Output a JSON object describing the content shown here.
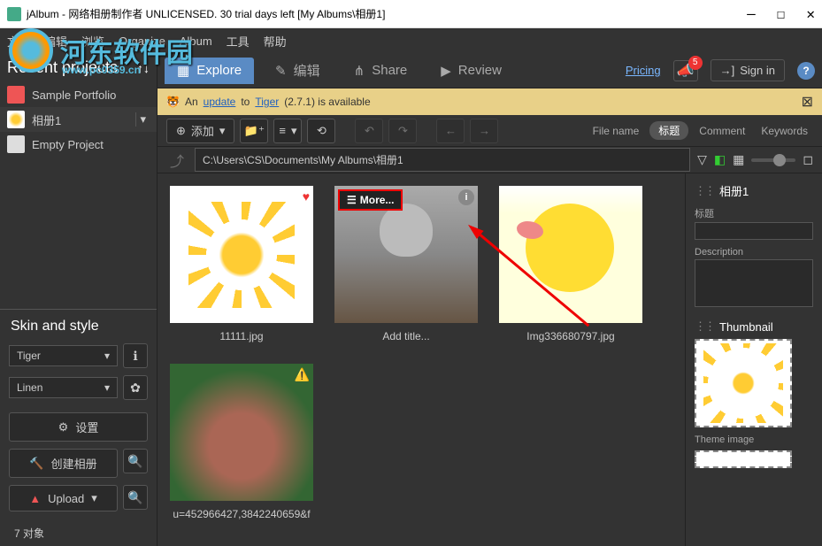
{
  "title": "jAlbum - 网络相册制作者 UNLICENSED. 30 trial days left [My Albums\\相册1]",
  "watermark": {
    "brand": "河东软件园",
    "url": "www.pc0359.cn"
  },
  "menu": [
    "文件",
    "编辑",
    "浏览",
    "Organize",
    "Album",
    "工具",
    "帮助"
  ],
  "sidebar": {
    "header": "Recent projects",
    "projects": [
      {
        "name": "Sample Portfolio",
        "icon": "flower"
      },
      {
        "name": "相册1",
        "icon": "sun",
        "selected": true
      },
      {
        "name": "Empty Project",
        "icon": "empty"
      }
    ],
    "skin_header": "Skin and style",
    "skin": "Tiger",
    "style": "Linen",
    "settings_label": "设置",
    "create_label": "创建相册",
    "upload_label": "Upload",
    "status": "7 对象"
  },
  "tabs": {
    "explore": "Explore",
    "edit": "编辑",
    "share": "Share",
    "review": "Review"
  },
  "topright": {
    "pricing": "Pricing",
    "notif_count": "5",
    "signin": "Sign in"
  },
  "infobar": {
    "prefix": "An",
    "update": "update",
    "to": "to",
    "tiger": "Tiger",
    "suffix": "(2.7.1) is available"
  },
  "toolbar": {
    "add": "添加",
    "columns": {
      "filename": "File name",
      "title": "标题",
      "comment": "Comment",
      "keywords": "Keywords"
    }
  },
  "path": "C:\\Users\\CS\\Documents\\My Albums\\相册1",
  "thumbs": [
    {
      "caption": "11111.jpg",
      "kind": "sun",
      "badge": "heart"
    },
    {
      "caption": "Add title...",
      "kind": "cat",
      "badge": "info",
      "more": "More..."
    },
    {
      "caption": "Img336680797.jpg",
      "kind": "duck"
    },
    {
      "caption": "u=452966427,3842240659&f",
      "kind": "squirrel",
      "badge": "warn"
    }
  ],
  "detail": {
    "title": "相册1",
    "title_label": "标题",
    "desc_label": "Description",
    "thumb_label": "Thumbnail",
    "theme_label": "Theme image"
  }
}
